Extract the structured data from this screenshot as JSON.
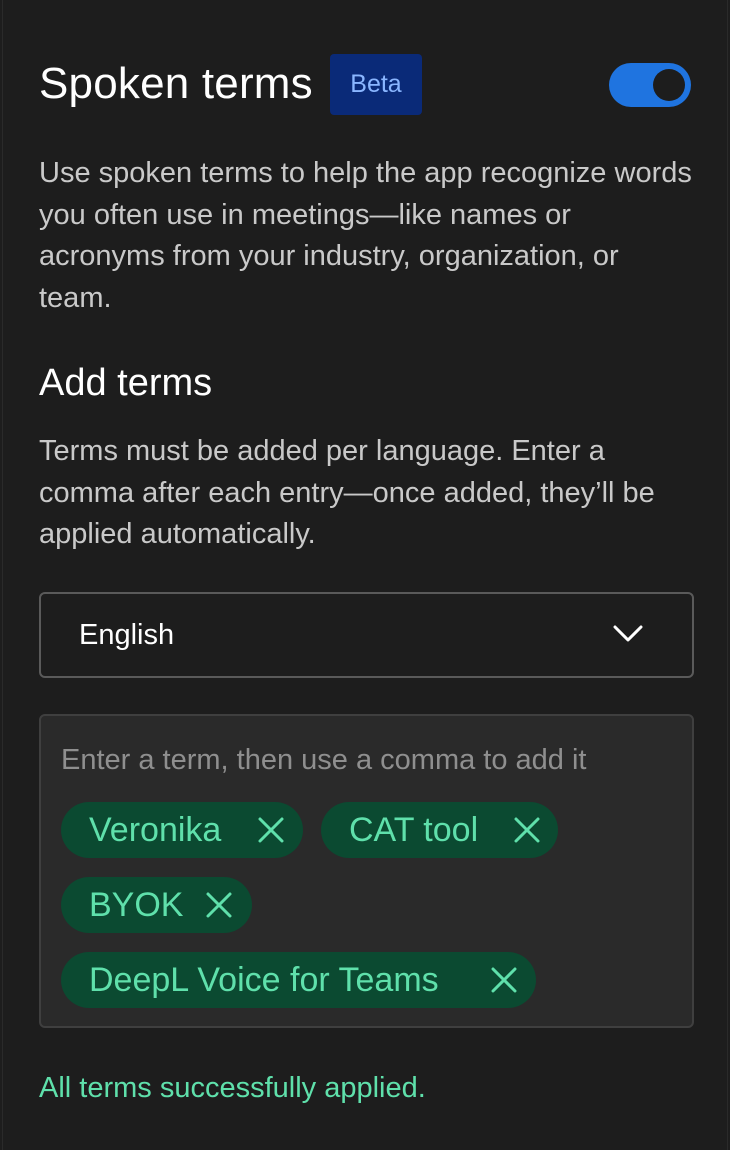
{
  "header": {
    "title": "Spoken terms",
    "badge": "Beta",
    "toggle": {
      "enabled": true,
      "accent": "#1f74e0"
    }
  },
  "description": "Use spoken terms to help the app recognize words you often use in meetings—like names or acronyms from your industry, organization, or team.",
  "add_terms": {
    "title": "Add terms",
    "description": "Terms must be added per language. Enter a comma after each entry—once added, they’ll be applied automatically.",
    "language_select": {
      "value": "English",
      "icon": "chevron-down-icon"
    },
    "input": {
      "placeholder": "Enter a term, then use a comma to add it",
      "value": ""
    },
    "terms": [
      {
        "label": "Veronika",
        "icon": "close-icon"
      },
      {
        "label": "CAT tool",
        "icon": "close-icon"
      },
      {
        "label": "BYOK",
        "icon": "close-icon"
      },
      {
        "label": "DeepL Voice for Teams",
        "icon": "close-icon"
      }
    ]
  },
  "status": "All terms successfully applied.",
  "colors": {
    "background": "#1d1d1d",
    "chip_background": "#0b4a31",
    "chip_text": "#5fe0ab",
    "badge_background": "#0a2a78",
    "badge_text": "#8ab6ff",
    "success_text": "#5fe0ab"
  }
}
